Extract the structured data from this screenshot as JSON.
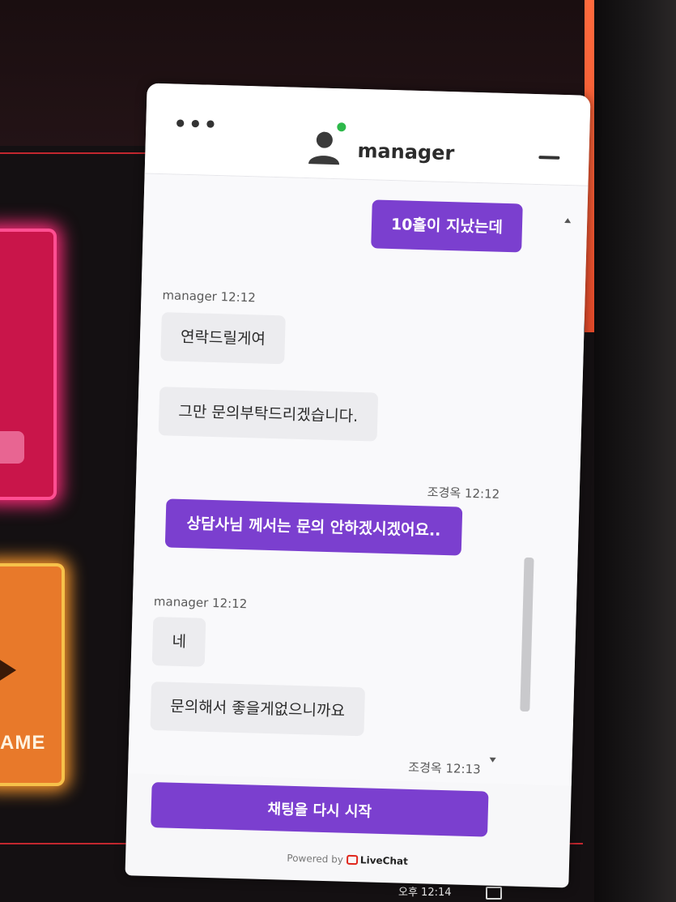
{
  "background": {
    "game_card_label": "AME",
    "taskbar_time": "오후 12:14"
  },
  "header": {
    "agent_name": "manager",
    "status_color": "#2db84a"
  },
  "messages": [
    {
      "sender": "visitor",
      "text": "10흘이 지났는데"
    },
    {
      "sender": "agent",
      "meta": "manager 12:12",
      "texts": [
        "연락드릴게여",
        "그만 문의부탁드리겠습니다."
      ]
    },
    {
      "sender": "visitor",
      "meta": "조경옥 12:12",
      "text": "상담사님 께서는 문의 안하겠시겠어요.."
    },
    {
      "sender": "agent",
      "meta": "manager 12:12",
      "texts": [
        "네",
        "문의해서 좋을게없으니까요"
      ]
    },
    {
      "sender": "visitor",
      "meta": "조경옥 12:13"
    }
  ],
  "footer": {
    "restart_label": "채팅을 다시 시작",
    "powered_by": "Powered by",
    "brand": "LiveChat"
  },
  "colors": {
    "accent": "#7b3fcf",
    "agent_bubble": "#ececef"
  }
}
